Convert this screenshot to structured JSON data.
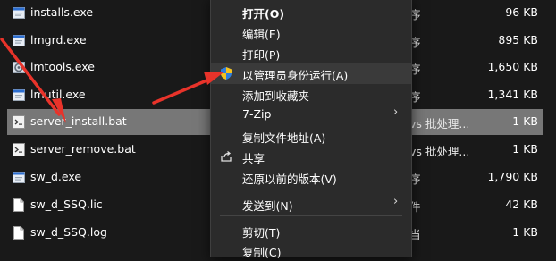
{
  "files": [
    {
      "name": "installs.exe",
      "type": "序",
      "size": "96 KB",
      "icon": "exe-icon"
    },
    {
      "name": "lmgrd.exe",
      "type": "序",
      "size": "895 KB",
      "icon": "exe-icon"
    },
    {
      "name": "lmtools.exe",
      "type": "序",
      "size": "1,650 KB",
      "icon": "tool-exe-icon"
    },
    {
      "name": "lmutil.exe",
      "type": "序",
      "size": "1,341 KB",
      "icon": "exe-icon"
    },
    {
      "name": "server_install.bat",
      "type": "vs 批处理...",
      "size": "1 KB",
      "icon": "bat-icon",
      "selected": true
    },
    {
      "name": "server_remove.bat",
      "type": "vs 批处理...",
      "size": "1 KB",
      "icon": "bat-icon"
    },
    {
      "name": "sw_d.exe",
      "type": "序",
      "size": "1,790 KB",
      "icon": "exe-icon"
    },
    {
      "name": "sw_d_SSQ.lic",
      "type": "件",
      "size": "42 KB",
      "icon": "file-icon"
    },
    {
      "name": "sw_d_SSQ.log",
      "type": "当",
      "size": "1 KB",
      "icon": "file-icon"
    }
  ],
  "context_menu": {
    "items": [
      {
        "label": "打开(O)",
        "bold": true
      },
      {
        "label": "编辑(E)"
      },
      {
        "label": "打印(P)"
      },
      {
        "label": "以管理员身份运行(A)",
        "icon": "uac-shield-icon",
        "hover": true
      },
      {
        "label": "添加到收藏夹"
      },
      {
        "label": "7-Zip",
        "submenu": true
      },
      {
        "label": "复制文件地址(A)"
      },
      {
        "label": "共享",
        "icon": "share-icon"
      },
      {
        "label": "还原以前的版本(V)"
      },
      {
        "label": "发送到(N)",
        "submenu": true
      },
      {
        "label": "剪切(T)"
      },
      {
        "label": "复制(C)"
      }
    ]
  },
  "colors": {
    "background": "#191919",
    "menu_background": "#2b2b2b",
    "selected_row": "#777777",
    "annotation_arrow": "#e8332a"
  }
}
